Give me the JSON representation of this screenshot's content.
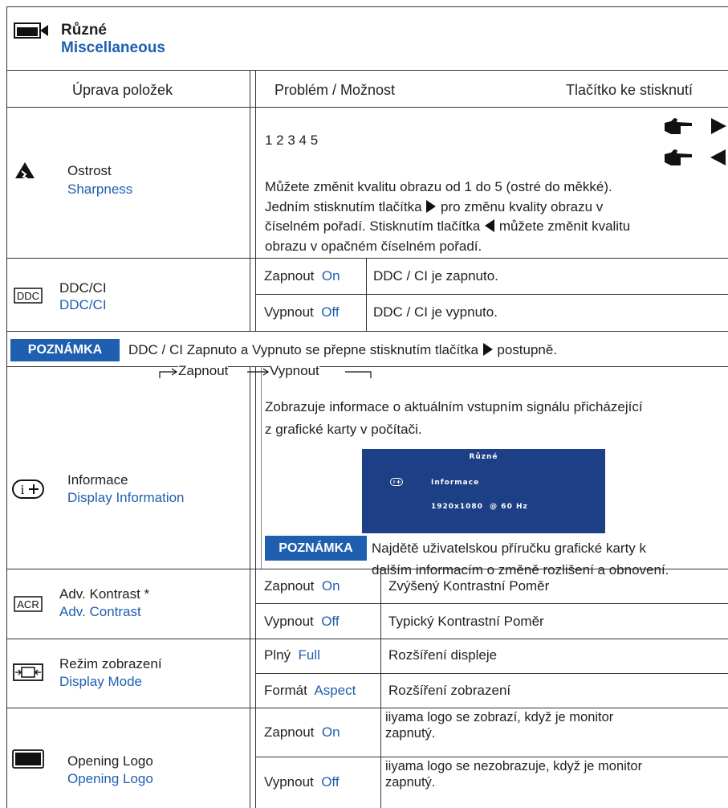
{
  "section": {
    "title_cz": "Různé",
    "title_en": "Miscellaneous",
    "icon": "misc-menu-icon"
  },
  "header": {
    "col1": "Úprava položek",
    "col2": "Problém / Možnost",
    "col3": "Tlačítko ke stisknutí"
  },
  "sharpness": {
    "icon": "sharpness-icon",
    "label_cz": "Ostrost",
    "label_en": "Sharpness",
    "levels": "1 2 3 4 5",
    "desc": [
      "Můžete změnit kvalitu obrazu od 1 do 5 (ostré do měkké).",
      "Jedním stisknutím tlačítka",
      "pro změnu kvality obrazu v",
      "číselném pořadí. Stisknutím tlačítka",
      "můžete změnit kvalitu",
      "obrazu v opačném číselném pořadí."
    ]
  },
  "ddc": {
    "icon": "ddc-icon",
    "label_cz": "DDC/CI",
    "label_en": "DDC/CI",
    "rows": [
      {
        "opt_cz": "Zapnout",
        "opt_en": "On",
        "desc": "DDC / CI je zapnuto."
      },
      {
        "opt_cz": "Vypnout",
        "opt_en": "Off",
        "desc": "DDC / CI je vypnuto."
      }
    ]
  },
  "note1": {
    "badge": "POZNÁMKA",
    "text_a": "DDC / CI Zapnuto a Vypnuto se přepne stisknutím tlačítka",
    "text_b": "postupně.",
    "cycle_on": "Zapnout",
    "cycle_off": "Vypnout"
  },
  "info": {
    "icon": "info-icon",
    "label_cz": "Informace",
    "label_en": "Display Information",
    "desc1": "Zobrazuje informace o aktuálním vstupním signálu přicházející",
    "desc2": "z grafické karty v počítači.",
    "osd": {
      "title": "Různé",
      "item": "Informace",
      "value": "1920x1080  @ 60 Hz",
      "bg": "#1c3f86"
    },
    "note_badge": "POZNÁMKA",
    "note1": "Najdětě uživatelskou příručku grafické karty k",
    "note2": "dalším informacím o změně rozlišení a obnovení."
  },
  "acr": {
    "icon": "acr-icon",
    "label_cz": "Adv. Kontrast *",
    "label_en": "Adv. Contrast",
    "rows": [
      {
        "opt_cz": "Zapnout",
        "opt_en": "On",
        "desc": "Zvýšený Kontrastní Poměr"
      },
      {
        "opt_cz": "Vypnout",
        "opt_en": "Off",
        "desc": "Typický Kontrastní Poměr"
      }
    ]
  },
  "mode": {
    "icon": "display-mode-icon",
    "label_cz": "Režim zobrazení",
    "label_en": "Display Mode",
    "rows": [
      {
        "opt_cz": "Plný",
        "opt_en": "Full",
        "desc": "Rozšíření displeje"
      },
      {
        "opt_cz": "Formát",
        "opt_en": "Aspect",
        "desc": "Rozšíření zobrazení"
      }
    ]
  },
  "logo": {
    "icon": "opening-logo-icon",
    "label_cz": "Opening Logo",
    "label_en": "Opening Logo",
    "rows": [
      {
        "opt_cz": "Zapnout",
        "opt_en": "On",
        "desc1": "iiyama logo se zobrazí, když je monitor",
        "desc2": "zapnutý."
      },
      {
        "opt_cz": "Vypnout",
        "opt_en": "Off",
        "desc1": "iiyama logo se nezobrazuje, když je monitor",
        "desc2": "zapnutý."
      }
    ]
  },
  "colors": {
    "accent": "#1f5fb0",
    "osd_bg": "#1c3f86"
  }
}
